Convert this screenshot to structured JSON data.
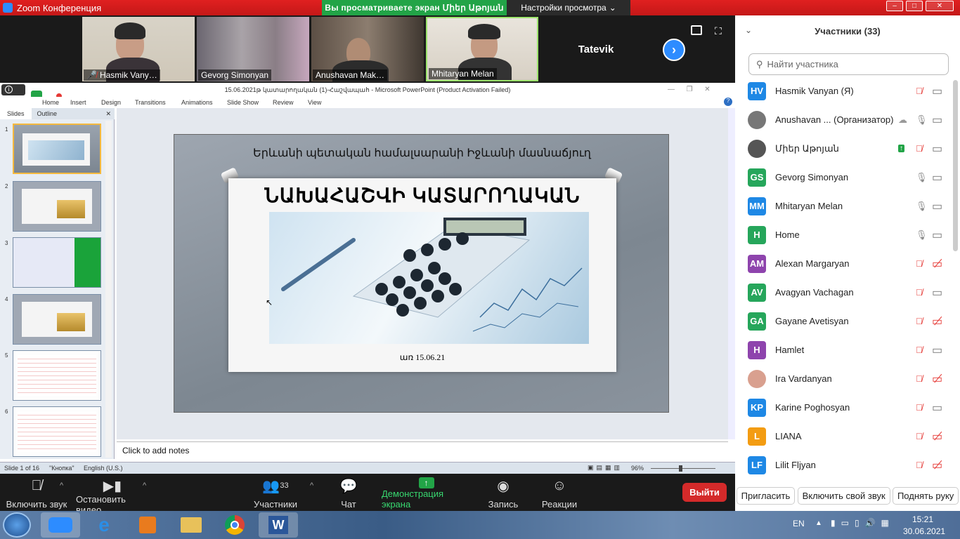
{
  "window": {
    "title": "Zoom Конференция",
    "share_banner": "Вы  просматриваете  экран Միեր Աթոյան",
    "view_settings": "Настройки просмотра"
  },
  "videos": [
    {
      "name": "Hasmik Vany…",
      "muted": true
    },
    {
      "name": "Gevorg Simonyan",
      "muted": false
    },
    {
      "name": "Anushavan Mak…",
      "muted": false
    },
    {
      "name": "Mhitaryan Melan",
      "muted": true
    },
    {
      "name": "Tatevik",
      "muted": false
    }
  ],
  "powerpoint": {
    "title": "15.06.2021թ կատարողական (1)-Հաշվապահ  -  Microsoft PowerPoint (Product Activation Failed)",
    "menu": [
      "Home",
      "Insert",
      "Design",
      "Transitions",
      "Animations",
      "Slide Show",
      "Review",
      "View"
    ],
    "tabs": [
      "Slides",
      "Outline"
    ],
    "slide_numbers": [
      "1",
      "2",
      "3",
      "4",
      "5",
      "6"
    ],
    "slide": {
      "header": "Երևանի պետական համալսարանի Իջևանի մասնաճյուղ",
      "title": "ՆԱԽԱՀԱՇՎԻ ԿԱՏԱՐՈՂԱԿԱՆ",
      "date": "առ 15.06.21"
    },
    "notes_placeholder": "Click to add notes",
    "status": {
      "slide_of": "Slide 1 of 16",
      "theme": "\"Кнопка\"",
      "language": "English (U.S.)",
      "zoom": "96%"
    }
  },
  "toolbar": {
    "audio": "Включить звук",
    "video": "Остановить видео",
    "participants": "Участники",
    "participants_count": "33",
    "chat": "Чат",
    "share": "Демонстрация экрана",
    "record": "Запись",
    "reactions": "Реакции",
    "leave": "Выйти"
  },
  "participants_panel": {
    "title": "Участники (33)",
    "search_placeholder": "Найти участника",
    "items": [
      {
        "initials": "HV",
        "name": "Hasmik Vanyan (Я)",
        "color": "#1e88e5",
        "mic": "muted",
        "cam": "on"
      },
      {
        "initials": "",
        "name": "Anushavan ...  (Организатор)",
        "color": "#777777",
        "mic": "on",
        "cam": "on"
      },
      {
        "initials": "",
        "name": "Միեր Աթոյան",
        "color": "#555555",
        "mic": "muted",
        "cam": "on"
      },
      {
        "initials": "GS",
        "name": "Gevorg Simonyan",
        "color": "#26a65b",
        "mic": "on",
        "cam": "on"
      },
      {
        "initials": "MM",
        "name": "Mhitaryan Melan",
        "color": "#1e88e5",
        "mic": "on",
        "cam": "on"
      },
      {
        "initials": "H",
        "name": "Home",
        "color": "#26a65b",
        "mic": "on",
        "cam": "on"
      },
      {
        "initials": "AM",
        "name": "Alexan Margaryan",
        "color": "#8e44ad",
        "mic": "muted",
        "cam": "off"
      },
      {
        "initials": "AV",
        "name": "Avagyan Vachagan",
        "color": "#26a65b",
        "mic": "muted",
        "cam": "on"
      },
      {
        "initials": "GA",
        "name": "Gayane Avetisyan",
        "color": "#26a65b",
        "mic": "muted",
        "cam": "off"
      },
      {
        "initials": "H",
        "name": "Hamlet",
        "color": "#8e44ad",
        "mic": "muted",
        "cam": "on"
      },
      {
        "initials": "",
        "name": "Ira Vardanyan",
        "color": "#d9a08f",
        "mic": "muted",
        "cam": "off"
      },
      {
        "initials": "KP",
        "name": "Karine Poghosyan",
        "color": "#1e88e5",
        "mic": "muted",
        "cam": "on"
      },
      {
        "initials": "L",
        "name": "LIANA",
        "color": "#f39c12",
        "mic": "muted",
        "cam": "off"
      },
      {
        "initials": "LF",
        "name": "Lilit Fljyan",
        "color": "#1e88e5",
        "mic": "muted",
        "cam": "off"
      }
    ],
    "footer": [
      "Пригласить",
      "Включить свой звук",
      "Поднять руку"
    ]
  },
  "taskbar": {
    "language": "EN",
    "time": "15:21",
    "date": "30.06.2021"
  },
  "colors": {
    "zoom_blue": "#2d8cff",
    "share_green": "#22a447",
    "leave_red": "#d42a2a",
    "muted_red": "#e53935"
  }
}
